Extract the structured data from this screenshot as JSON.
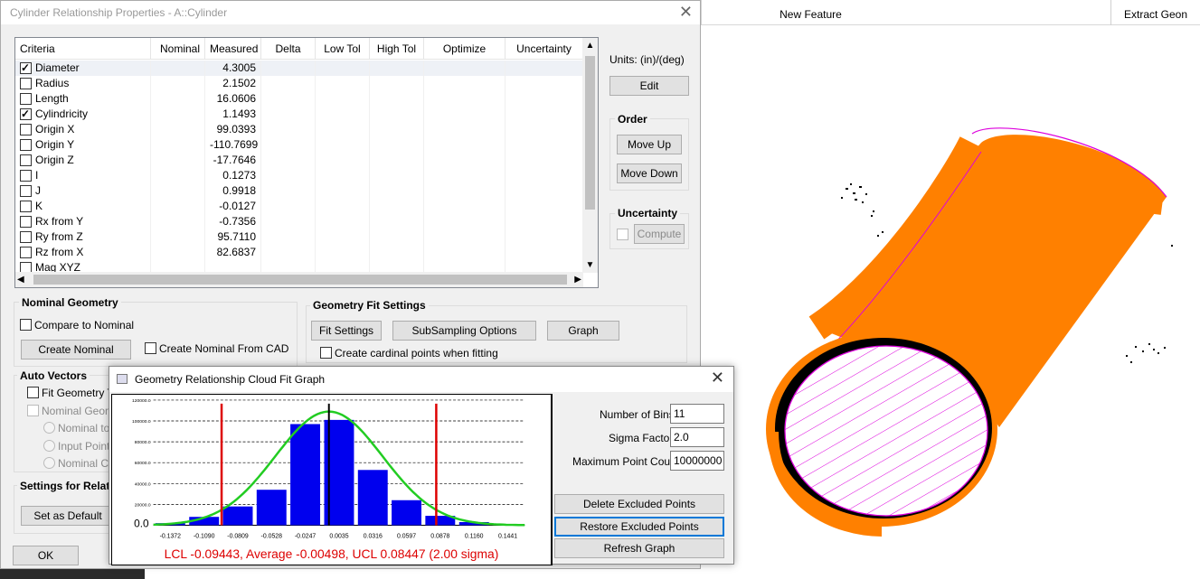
{
  "background_app": {
    "tabs": [
      "New Feature",
      "Extract Geon"
    ]
  },
  "main_dialog": {
    "title": "Cylinder Relationship Properties - A::Cylinder",
    "columns": [
      "Criteria",
      "Nominal",
      "Measured",
      "Delta",
      "Low Tol",
      "High Tol",
      "Optimize",
      "Uncertainty"
    ],
    "rows": [
      {
        "label": "Diameter",
        "checked": true,
        "measured": "4.3005"
      },
      {
        "label": "Radius",
        "checked": false,
        "measured": "2.1502"
      },
      {
        "label": "Length",
        "checked": false,
        "measured": "16.0606"
      },
      {
        "label": "Cylindricity",
        "checked": true,
        "measured": "1.1493"
      },
      {
        "label": "Origin X",
        "checked": false,
        "measured": "99.0393"
      },
      {
        "label": "Origin Y",
        "checked": false,
        "measured": "-110.7699"
      },
      {
        "label": "Origin Z",
        "checked": false,
        "measured": "-17.7646"
      },
      {
        "label": "I",
        "checked": false,
        "measured": "0.1273"
      },
      {
        "label": "J",
        "checked": false,
        "measured": "0.9918"
      },
      {
        "label": "K",
        "checked": false,
        "measured": "-0.0127"
      },
      {
        "label": "Rx from Y",
        "checked": false,
        "measured": "-0.7356"
      },
      {
        "label": "Ry from Z",
        "checked": false,
        "measured": "95.7110"
      },
      {
        "label": "Rz from X",
        "checked": false,
        "measured": "82.6837"
      },
      {
        "label": "Mag XYZ",
        "checked": false,
        "measured": ""
      }
    ],
    "units_label": "Units: (in)/(deg)",
    "edit_button": "Edit",
    "order": {
      "title": "Order",
      "move_up": "Move Up",
      "move_down": "Move Down"
    },
    "uncertainty": {
      "title": "Uncertainty",
      "compute": "Compute"
    },
    "nominal_geometry": {
      "title": "Nominal Geometry",
      "compare_to_nominal": "Compare to Nominal",
      "create_nominal": "Create Nominal",
      "create_nominal_from_cad": "Create Nominal From CAD"
    },
    "geometry_fit": {
      "title": "Geometry Fit Settings",
      "fit_settings": "Fit Settings",
      "subsampling": "SubSampling Options",
      "graph": "Graph",
      "cardinal_points": "Create cardinal points when fitting"
    },
    "auto_vectors": {
      "title": "Auto Vectors",
      "fit_geometry": "Fit Geometry To",
      "nominal_geometry": "Nominal Geome",
      "nominal_to": "Nominal to F",
      "input_points": "Input Points",
      "nominal_car": "Nominal Car"
    },
    "settings": {
      "title": "Settings for Relat",
      "set_as_default": "Set as Default"
    },
    "ok_button": "OK"
  },
  "graph_dialog": {
    "title": "Geometry Relationship Cloud Fit Graph",
    "number_of_bins_label": "Number of Bins",
    "number_of_bins": "11",
    "sigma_factor_label": "Sigma Factor",
    "sigma_factor": "2.0",
    "max_point_count_label": "Maximum Point Count",
    "max_point_count": "10000000",
    "delete_excluded": "Delete Excluded Points",
    "restore_excluded": "Restore Excluded Points",
    "refresh_graph": "Refresh Graph",
    "summary": "LCL -0.09443, Average -0.00498, UCL 0.08447 (2.00 sigma)"
  },
  "chart_data": {
    "type": "bar",
    "x": [
      -0.1372,
      -0.109,
      -0.0809,
      -0.0528,
      -0.0247,
      0.0035,
      0.0316,
      0.0597,
      0.0878,
      0.116,
      0.1441
    ],
    "x_tick_labels": [
      "-0.1372",
      "-0.1090",
      "-0.0809",
      "-0.0528",
      "-0.0247",
      "0.0035",
      "0.0316",
      "0.0597",
      "0.0878",
      "0.1160",
      "0.1441"
    ],
    "values": [
      2000,
      8000,
      18000,
      34000,
      97000,
      101000,
      53000,
      24000,
      9000,
      3000,
      800
    ],
    "ylim": [
      0,
      120000
    ],
    "y_tick_labels": [
      "120000.0",
      "100000.0",
      "80000.0",
      "60000.0",
      "40000.0",
      "20000.0"
    ],
    "y_zero_label": "0.0",
    "lcl": -0.09443,
    "ucl": 0.08447,
    "average": -0.00498,
    "grid": "horizontal-dashed",
    "colors": {
      "bars": "#0000ee",
      "curve": "#22cc22",
      "limits": "#dd0000",
      "average": "#000000"
    }
  },
  "colors": {
    "cloud": "#ff8000",
    "hatch": "#dd00dd",
    "summary_text": "#dd0000"
  }
}
